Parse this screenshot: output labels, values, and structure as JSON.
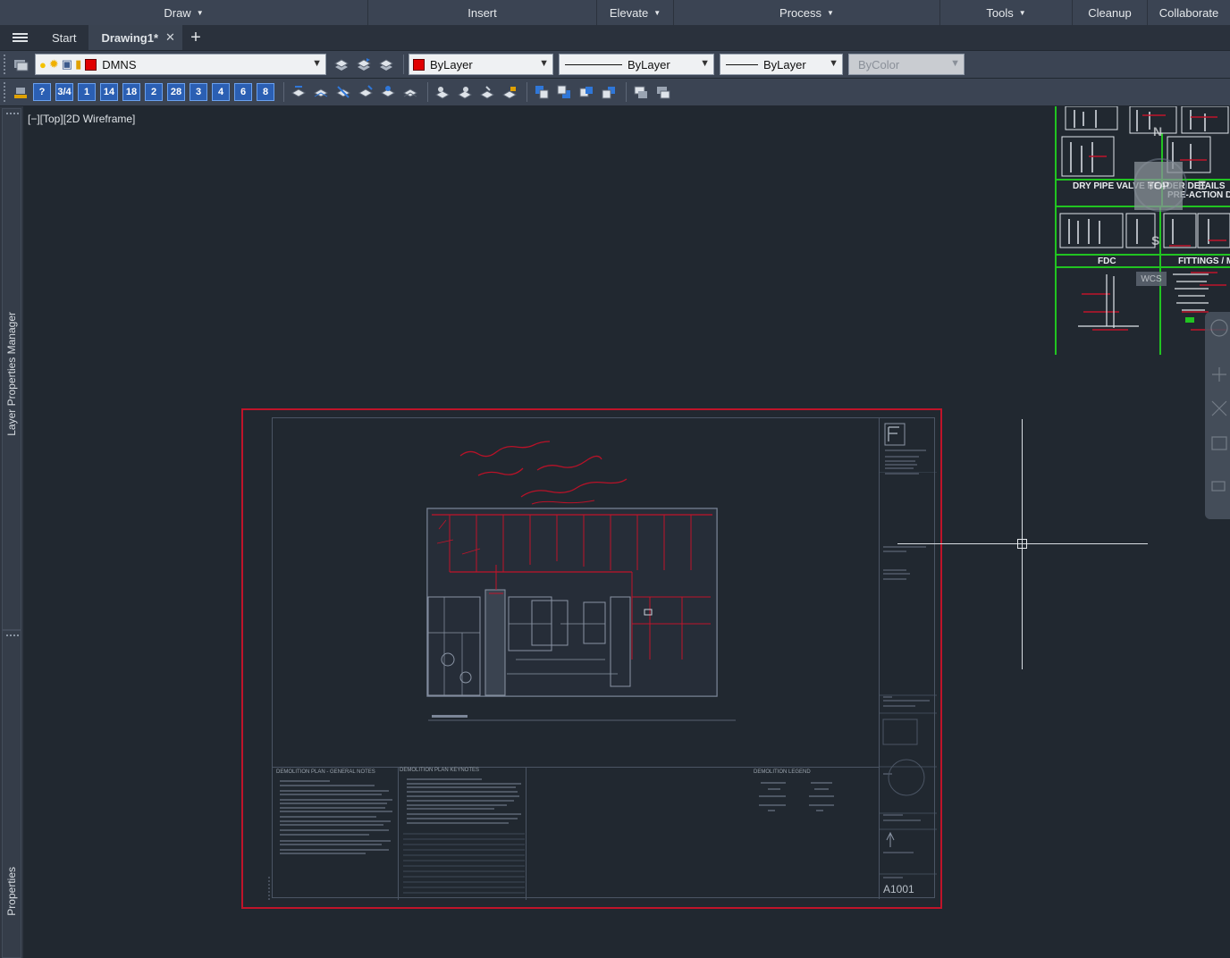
{
  "ribbon_panels": [
    {
      "label": "Draw",
      "has_menu": true
    },
    {
      "label": "Insert",
      "has_menu": false
    },
    {
      "label": "Elevate",
      "has_menu": true
    },
    {
      "label": "Process",
      "has_menu": true
    },
    {
      "label": "Tools",
      "has_menu": true
    },
    {
      "label": "Cleanup",
      "has_menu": false
    },
    {
      "label": "Collaborate",
      "has_menu": false
    }
  ],
  "tabs": {
    "start": "Start",
    "drawing": "Drawing1*",
    "close_glyph": "✕",
    "new_glyph": "+"
  },
  "toolbar": {
    "layer_name": "DMNS",
    "color": "ByLayer",
    "linetype": "ByLayer",
    "lineweight": "ByLayer",
    "plotstyle": "ByColor",
    "layer_color": "#e00000"
  },
  "numbered_layer_icons": [
    "?",
    "3/4",
    "1",
    "14",
    "18",
    "2",
    "28",
    "3",
    "4",
    "6",
    "8"
  ],
  "palettes": {
    "layer_manager": "Layer Properties Manager",
    "properties": "Properties"
  },
  "viewport": {
    "label": "[−][Top][2D Wireframe]"
  },
  "sheet": {
    "number": "A1001",
    "notes_title_general": "DEMOLITION PLAN - GENERAL NOTES",
    "notes_title_keynotes": "DEMOLITION PLAN KEYNOTES",
    "legend_title": "DEMOLITION LEGEND"
  },
  "details": {
    "dry_pipe": "DRY PIPE VALVE HEADER DETAILS",
    "preaction": "PRE-ACTION DE",
    "fdc": "FDC",
    "fittings": "FITTINGS / M"
  },
  "viewcube": {
    "top": "TOP",
    "n": "N",
    "e": "E",
    "s": "S",
    "wcs": "WCS"
  },
  "colors": {
    "background": "#212830",
    "sheet_border": "#c0142a",
    "detail_border": "#21c421"
  }
}
